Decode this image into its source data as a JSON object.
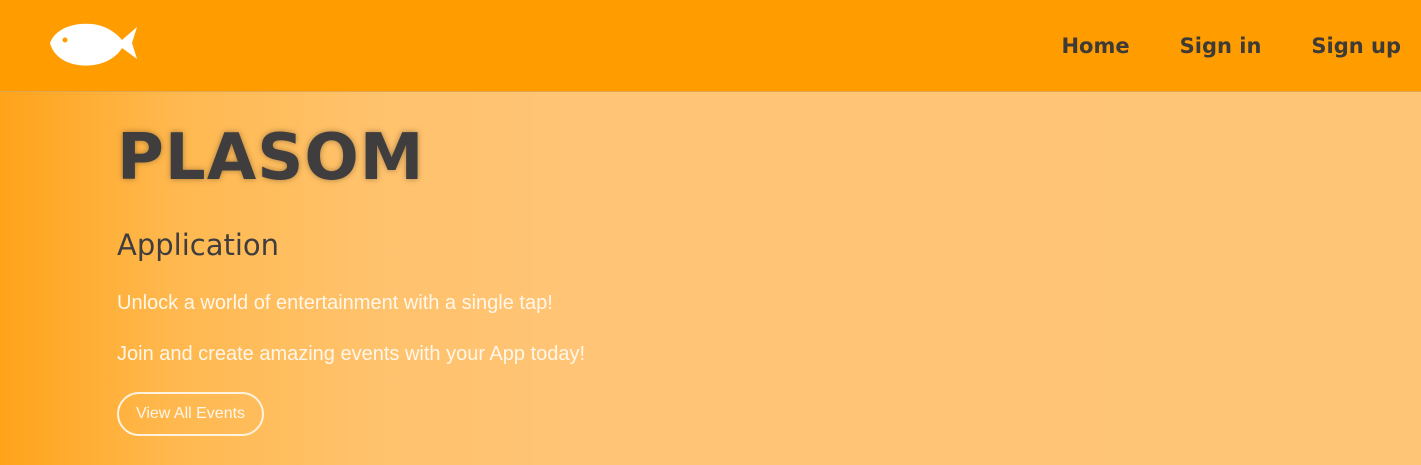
{
  "header": {
    "logo_icon": "fish-logo-icon",
    "nav": [
      {
        "label": "Home"
      },
      {
        "label": "Sign in"
      },
      {
        "label": "Sign up"
      }
    ]
  },
  "hero": {
    "title": "PLASOM",
    "subtitle": "Application",
    "line1": "Unlock a world of entertainment with a single tap!",
    "line2": "Join and create amazing events with your  App today!",
    "button_label": "View All Events"
  },
  "colors": {
    "navbar_bg": "#ff9c00",
    "hero_gradient_start": "#ffa31a",
    "hero_gradient_end": "#ffc576",
    "dark_text": "#3f3d3d",
    "light_text": "#fff7ea"
  }
}
